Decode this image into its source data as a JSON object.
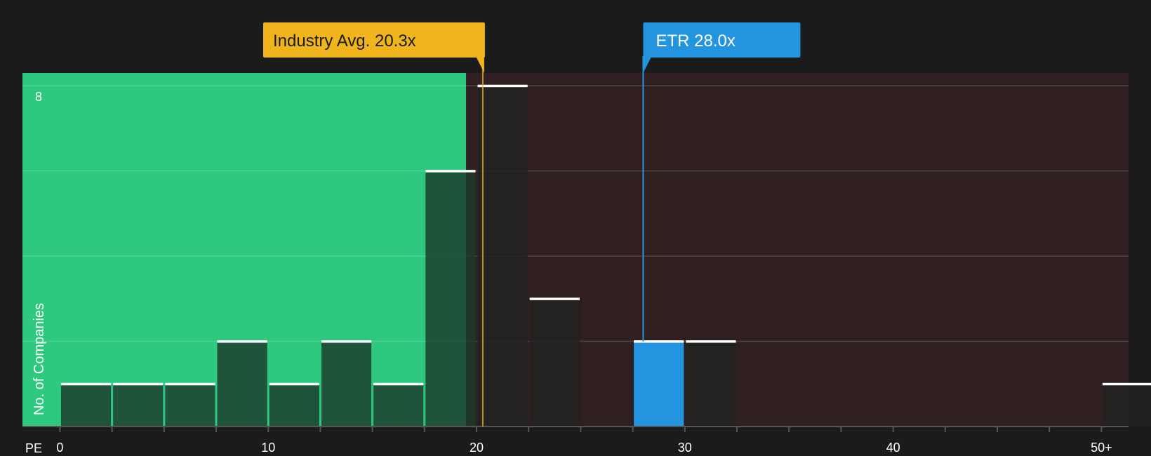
{
  "chart_data": {
    "type": "bar",
    "xlabel": "PE",
    "ylabel": "No. of Companies",
    "y_tick_labels": [
      "8"
    ],
    "x_tick_labels": [
      "0",
      "10",
      "20",
      "30",
      "40",
      "50+"
    ],
    "x_tick_values": [
      0,
      10,
      20,
      30,
      40,
      50
    ],
    "xlim": [
      -1.8,
      51.3
    ],
    "ylim": [
      0,
      8.3
    ],
    "bins": [
      {
        "x0": 0,
        "x1": 2.5,
        "count": 1
      },
      {
        "x0": 2.5,
        "x1": 5,
        "count": 1
      },
      {
        "x0": 5,
        "x1": 7.5,
        "count": 1
      },
      {
        "x0": 7.5,
        "x1": 10,
        "count": 2
      },
      {
        "x0": 10,
        "x1": 12.5,
        "count": 1
      },
      {
        "x0": 12.5,
        "x1": 15,
        "count": 2
      },
      {
        "x0": 15,
        "x1": 17.5,
        "count": 1
      },
      {
        "x0": 17.5,
        "x1": 20,
        "count": 6
      },
      {
        "x0": 20,
        "x1": 22.5,
        "count": 8
      },
      {
        "x0": 22.5,
        "x1": 25,
        "count": 3
      },
      {
        "x0": 27.5,
        "x1": 30,
        "count": 2,
        "highlight": true
      },
      {
        "x0": 30,
        "x1": 32.5,
        "count": 2
      },
      {
        "x0": 50,
        "x1": 52.5,
        "count": 1
      }
    ],
    "industry_avg": {
      "label": "Industry Avg. 20.3x",
      "value": 20.3
    },
    "company": {
      "label": "ETR 28.0x",
      "value": 28.0
    },
    "colors": {
      "background": "#1b1b1b",
      "undervalued_zone": "#2ec97f",
      "overvalued_zone": "#2f1f20",
      "bar": "#222222",
      "highlight_bar": "#2394e0",
      "industry_callout": "#f0b41c",
      "company_callout": "#2394e0",
      "cap": "#ffffff"
    }
  }
}
